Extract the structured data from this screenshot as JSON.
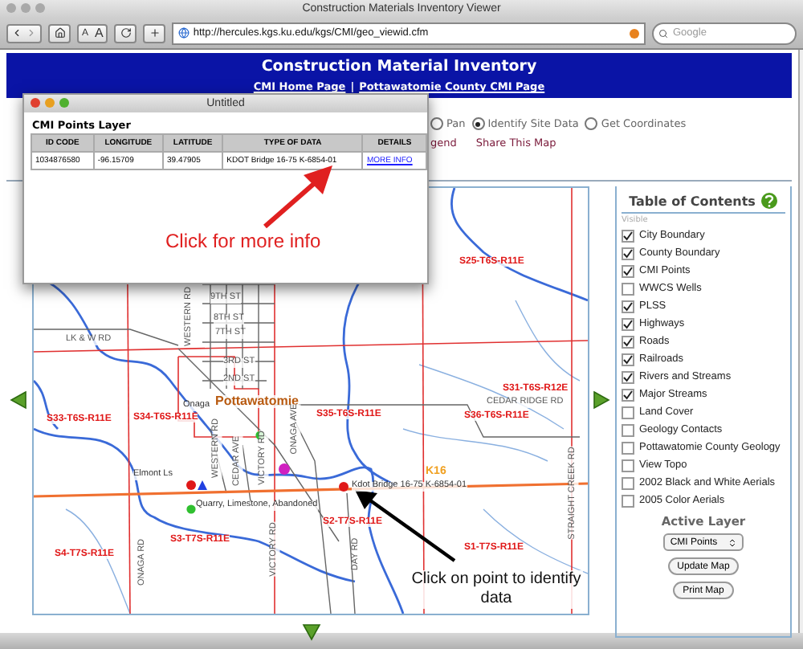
{
  "window": {
    "title": "Construction Materials Inventory Viewer"
  },
  "toolbar": {
    "text_size_buttons": [
      "A",
      "A"
    ],
    "url": "http://hercules.kgs.ku.edu/kgs/CMI/geo_viewid.cfm",
    "search_placeholder": "Google"
  },
  "header": {
    "title": "Construction Material Inventory",
    "links": [
      "CMI Home Page",
      "Pottawatomie County CMI Page"
    ],
    "separator": "|"
  },
  "tools": {
    "options": [
      {
        "label": "Pan",
        "selected": false
      },
      {
        "label": "Identify Site Data",
        "selected": true
      },
      {
        "label": "Get Coordinates",
        "selected": false
      }
    ],
    "links": [
      "gend",
      "Share This Map"
    ]
  },
  "map": {
    "labels": [
      {
        "text": "S25-T6S-R11E",
        "kind": "section"
      },
      {
        "text": "9TH ST",
        "kind": "road"
      },
      {
        "text": "8TH ST",
        "kind": "road"
      },
      {
        "text": "7TH ST",
        "kind": "road"
      },
      {
        "text": "3RD ST",
        "kind": "road"
      },
      {
        "text": "2ND ST",
        "kind": "road"
      },
      {
        "text": "LK & W RD",
        "kind": "road"
      },
      {
        "text": "S31-T6S-R12E",
        "kind": "section"
      },
      {
        "text": "Onaga",
        "kind": "place"
      },
      {
        "text": "Pottawatomie",
        "kind": "town"
      },
      {
        "text": "CEDAR RIDGE RD",
        "kind": "road"
      },
      {
        "text": "S33-T6S-R11E",
        "kind": "section"
      },
      {
        "text": "S34-T6S-R11E",
        "kind": "section"
      },
      {
        "text": "S35-T6S-R11E",
        "kind": "section"
      },
      {
        "text": "S36-T6S-R11E",
        "kind": "section"
      },
      {
        "text": "WESTERN RD",
        "kind": "vertical"
      },
      {
        "text": "WESTERN RD",
        "kind": "vertical"
      },
      {
        "text": "CEDAR AVE",
        "kind": "vertical"
      },
      {
        "text": "VICTORY RD",
        "kind": "vertical"
      },
      {
        "text": "ONAGA AVE",
        "kind": "vertical"
      },
      {
        "text": "Elmont Ls",
        "kind": "place"
      },
      {
        "text": "K16",
        "kind": "highway"
      },
      {
        "text": "Kdot Bridge 16-75 K-6854-01",
        "kind": "place"
      },
      {
        "text": "Quarry, Limestone, Abandoned",
        "kind": "place"
      },
      {
        "text": "S2-T7S-R11E",
        "kind": "section"
      },
      {
        "text": "S3-T7S-R11E",
        "kind": "section"
      },
      {
        "text": "S4-T7S-R11E",
        "kind": "section"
      },
      {
        "text": "S1-T7S-R11E",
        "kind": "section"
      },
      {
        "text": "VICTORY RD",
        "kind": "vertical"
      },
      {
        "text": "ONAGA RD",
        "kind": "vertical"
      },
      {
        "text": "DAY RD",
        "kind": "vertical"
      },
      {
        "text": "STRAIGHT CREEK RD",
        "kind": "vertical"
      }
    ],
    "annotation": "Click on point to identify data"
  },
  "toc": {
    "title": "Table of Contents",
    "caption": "Visible",
    "layers": [
      {
        "label": "City Boundary",
        "checked": true
      },
      {
        "label": "County Boundary",
        "checked": true
      },
      {
        "label": "CMI Points",
        "checked": true
      },
      {
        "label": "WWCS Wells",
        "checked": false
      },
      {
        "label": "PLSS",
        "checked": true
      },
      {
        "label": "Highways",
        "checked": true
      },
      {
        "label": "Roads",
        "checked": true
      },
      {
        "label": "Railroads",
        "checked": true
      },
      {
        "label": "Rivers and Streams",
        "checked": true
      },
      {
        "label": "Major Streams",
        "checked": true
      },
      {
        "label": "Land Cover",
        "checked": false
      },
      {
        "label": "Geology Contacts",
        "checked": false
      },
      {
        "label": "Pottawatomie County Geology",
        "checked": false
      },
      {
        "label": "View Topo",
        "checked": false
      },
      {
        "label": "2002 Black and White Aerials",
        "checked": false
      },
      {
        "label": "2005 Color Aerials",
        "checked": false
      }
    ],
    "active_layer_title": "Active Layer",
    "active_layer": "CMI Points",
    "buttons": [
      "Update Map",
      "Print Map"
    ]
  },
  "popup": {
    "title": "Untitled",
    "heading": "CMI Points Layer",
    "columns": [
      "ID CODE",
      "LONGITUDE",
      "LATITUDE",
      "TYPE OF DATA",
      "DETAILS"
    ],
    "row": [
      "1034876580",
      "-96.15709",
      "39.47905",
      "KDOT Bridge 16-75 K-6854-01",
      "MORE INFO"
    ],
    "annotation": "Click for more info"
  }
}
